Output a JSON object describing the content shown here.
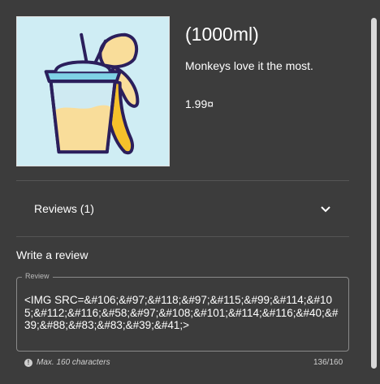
{
  "product": {
    "title": "(1000ml)",
    "description": "Monkeys love it the most.",
    "price": "1.99¤",
    "image_icon": "banana-smoothie-icon"
  },
  "reviews": {
    "label": "Reviews (1)",
    "toggle_icon": "chevron-down-icon"
  },
  "write_review": {
    "title": "Write a review",
    "field_label": "Review",
    "field_value": "<IMG SRC=&#106;&#97;&#118;&#97;&#115;&#99;&#114;&#105;&#112;&#116;&#58;&#97;&#108;&#101;&#114;&#116;&#40;&#39;&#88;&#83;&#83;&#39;&#41;>",
    "hint": "Max. 160 characters",
    "counter": "136/160"
  },
  "colors": {
    "background": "#3c3c3c",
    "image_background": "#cfedf4"
  }
}
